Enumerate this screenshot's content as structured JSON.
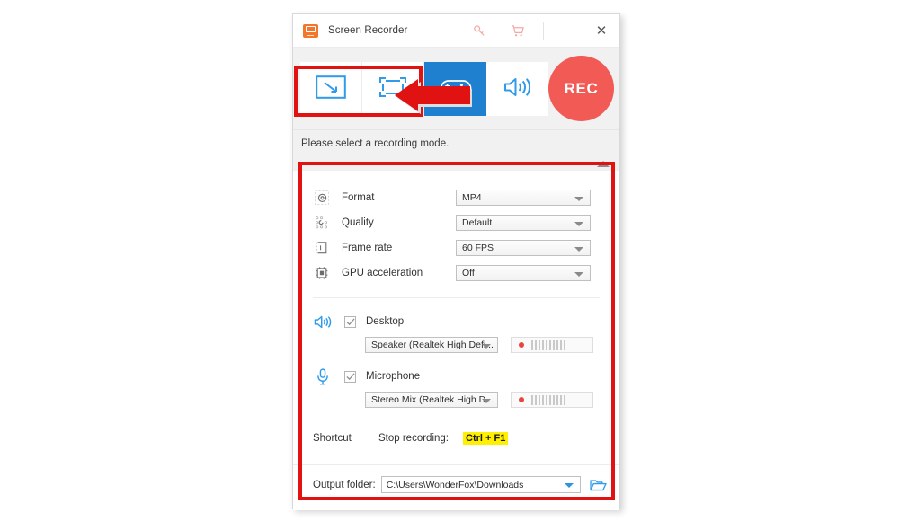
{
  "window": {
    "title": "Screen Recorder",
    "logo_icon": "screen-recorder-logo-icon",
    "titlebar_icons": [
      {
        "name": "key-icon",
        "label": "Register"
      },
      {
        "name": "cart-icon",
        "label": "Buy"
      }
    ],
    "minimize_label": "Minimize",
    "close_label": "Close"
  },
  "toolbar": {
    "modes": [
      {
        "id": "custom-region",
        "icon": "custom-region-icon",
        "active": false,
        "highlighted": true
      },
      {
        "id": "full-screen",
        "icon": "full-screen-icon",
        "active": false,
        "highlighted": true
      },
      {
        "id": "game-recording",
        "icon": "gamepad-icon",
        "active": true,
        "highlighted": false
      },
      {
        "id": "audio-recording",
        "icon": "speaker-icon",
        "active": false,
        "highlighted": false
      }
    ],
    "rec_label": "REC",
    "rec_color": "#f25a56"
  },
  "hint": {
    "text": "Please select a recording mode.",
    "collapse_icon": "collapse-up-arrow-icon"
  },
  "settings": {
    "rows": [
      {
        "icon": "format-gear-icon",
        "label": "Format",
        "value": "MP4"
      },
      {
        "icon": "quality-dots-icon",
        "label": "Quality",
        "value": "Default"
      },
      {
        "icon": "frame-rate-icon",
        "label": "Frame rate",
        "value": "60 FPS"
      },
      {
        "icon": "gpu-chip-icon",
        "label": "GPU acceleration",
        "value": "Off"
      }
    ]
  },
  "audio": {
    "desktop": {
      "icon": "speaker-icon",
      "label": "Desktop",
      "checked": true,
      "device": "Speaker (Realtek High Defi...",
      "meter_bars": 10
    },
    "microphone": {
      "icon": "microphone-icon",
      "label": "Microphone",
      "checked": true,
      "device": "Stereo Mix (Realtek High D...",
      "meter_bars": 10
    }
  },
  "shortcut": {
    "title": "Shortcut",
    "stop_label": "Stop recording:",
    "key": "Ctrl + F1",
    "highlight_color": "#ffef00"
  },
  "output": {
    "label": "Output folder:",
    "path": "C:\\Users\\WonderFox\\Downloads",
    "browse_icon": "folder-open-icon"
  },
  "annotations": {
    "color": "#e11212",
    "box_modes": "recording-mode-buttons-highlight",
    "box_panel": "settings-panel-highlight",
    "arrow": "pointer-arrow-to-modes"
  }
}
